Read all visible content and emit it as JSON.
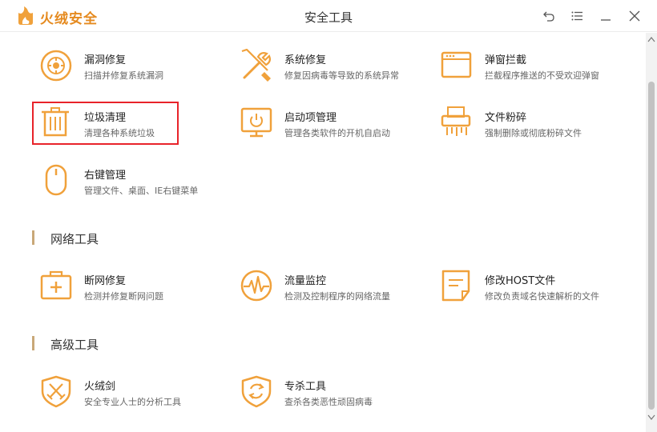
{
  "app": {
    "brand": "火绒安全",
    "window_title": "安全工具",
    "controls": [
      "back-icon",
      "menu-icon",
      "minimize-icon",
      "close-icon"
    ]
  },
  "colors": {
    "accent": "#f0a13b",
    "brand": "#e58a1f",
    "highlight_border": "#e8232a",
    "section_bar": "#c9a878"
  },
  "system_tools": [
    {
      "name": "漏洞修复",
      "desc": "扫描并修复系统漏洞",
      "icon": "lifebuoy-icon"
    },
    {
      "name": "系统修复",
      "desc": "修复因病毒等导致的系统异常",
      "icon": "wrench-screwdriver-icon"
    },
    {
      "name": "弹窗拦截",
      "desc": "拦截程序推送的不受欢迎弹窗",
      "icon": "popup-window-icon"
    },
    {
      "name": "垃圾清理",
      "desc": "清理各种系统垃圾",
      "icon": "trash-icon"
    },
    {
      "name": "启动项管理",
      "desc": "管理各类软件的开机自启动",
      "icon": "monitor-power-icon"
    },
    {
      "name": "文件粉碎",
      "desc": "强制删除或彻底粉碎文件",
      "icon": "shredder-icon"
    },
    {
      "name": "右键管理",
      "desc": "管理文件、桌面、IE右键菜单",
      "icon": "mouse-icon"
    }
  ],
  "network_section": {
    "label": "网络工具"
  },
  "network_tools": [
    {
      "name": "断网修复",
      "desc": "检测并修复断网问题",
      "icon": "medical-kit-icon"
    },
    {
      "name": "流量监控",
      "desc": "检测及控制程序的网络流量",
      "icon": "pulse-icon"
    },
    {
      "name": "修改HOST文件",
      "desc": "修改负责域名快速解析的文件",
      "icon": "document-edit-icon"
    }
  ],
  "advanced_section": {
    "label": "高级工具"
  },
  "advanced_tools": [
    {
      "name": "火绒剑",
      "desc": "安全专业人士的分析工具",
      "icon": "shield-swords-icon"
    },
    {
      "name": "专杀工具",
      "desc": "查杀各类恶性顽固病毒",
      "icon": "shield-refresh-icon"
    }
  ]
}
